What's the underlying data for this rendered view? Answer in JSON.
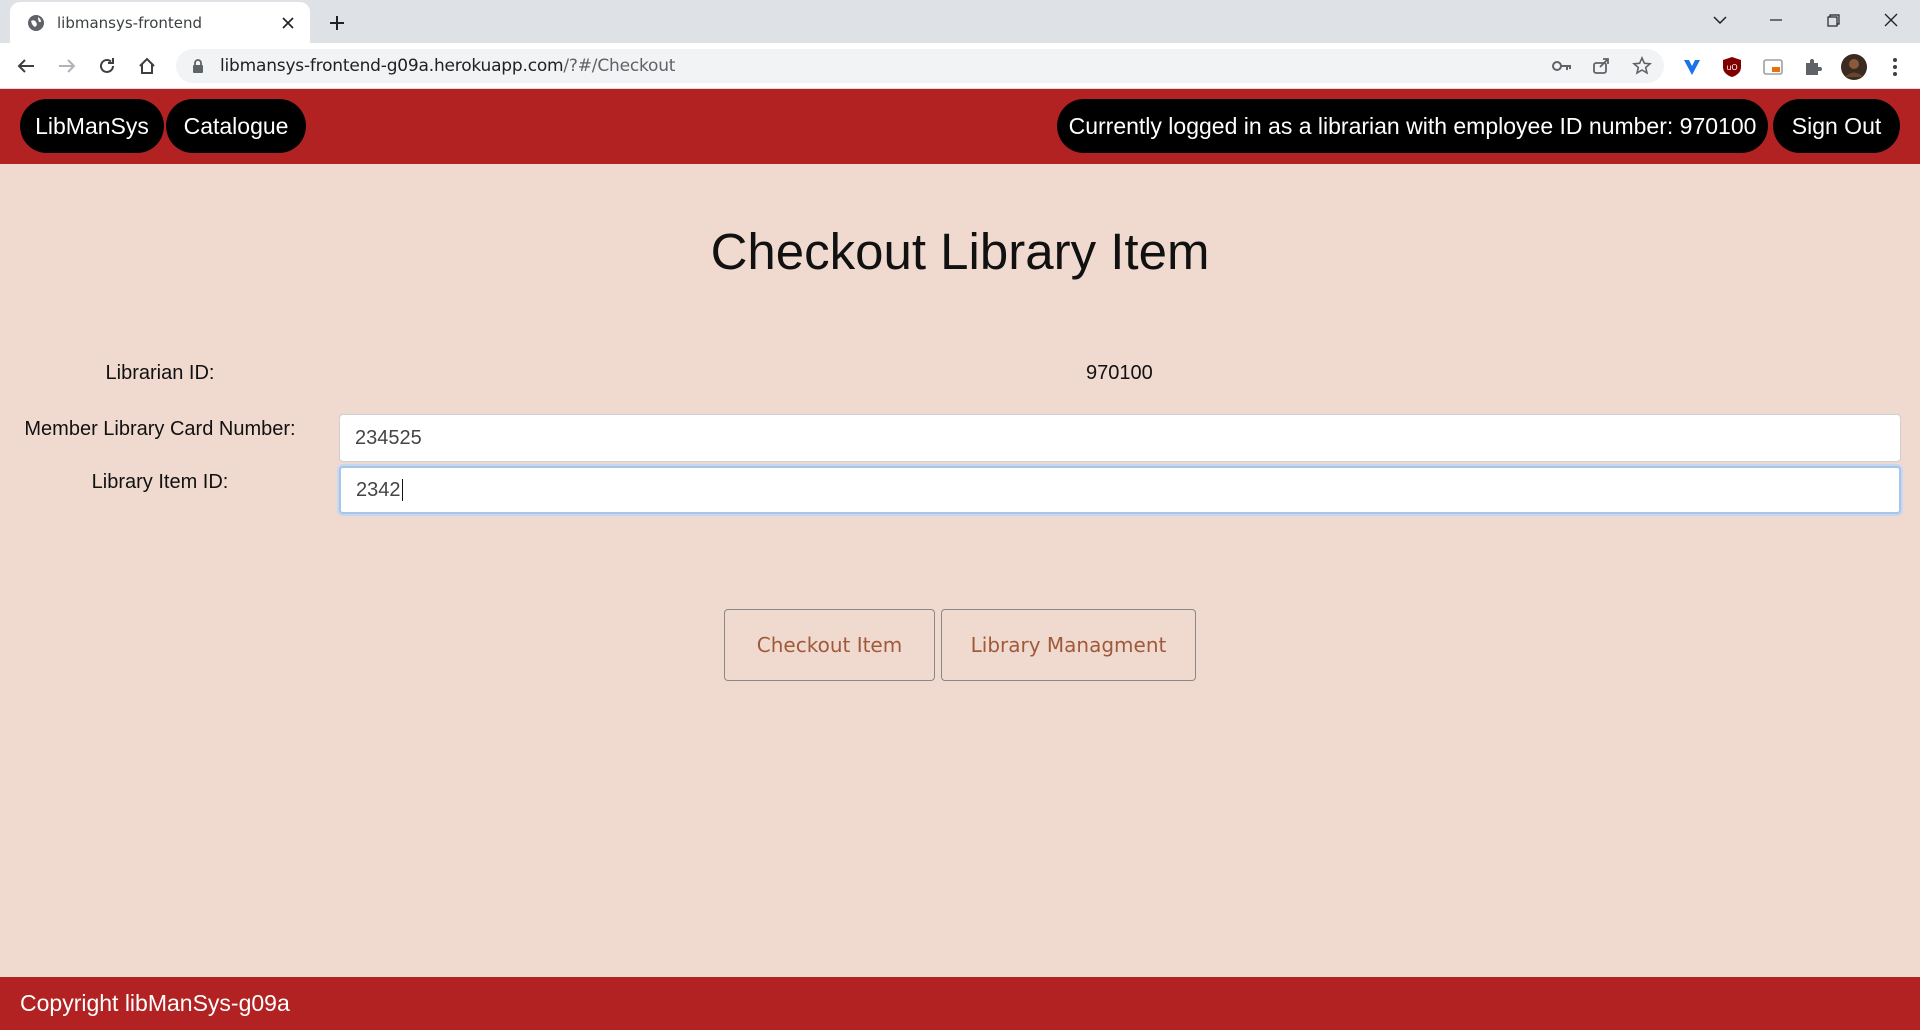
{
  "browser": {
    "tab_title": "libmansys-frontend",
    "url_host": "libmansys-frontend-g09a.herokuapp.com",
    "url_path": "/?#/Checkout"
  },
  "header": {
    "brand_label": "LibManSys",
    "catalogue_label": "Catalogue",
    "logged_in_text": "Currently logged in as a librarian with employee ID number: 970100",
    "sign_out_label": "Sign Out"
  },
  "main": {
    "title": "Checkout Library Item",
    "librarian_id_label": "Librarian ID:",
    "librarian_id_value": "970100",
    "member_card_label": "Member Library Card Number:",
    "member_card_value": "234525",
    "item_id_label": "Library Item ID:",
    "item_id_value": "2342"
  },
  "actions": {
    "checkout_label": "Checkout Item",
    "management_label": "Library Managment"
  },
  "footer": {
    "copyright": "Copyright libManSys-g09a"
  },
  "colors": {
    "header_red": "#b22222",
    "page_bg": "#f0dad0",
    "pill_black": "#000000"
  }
}
